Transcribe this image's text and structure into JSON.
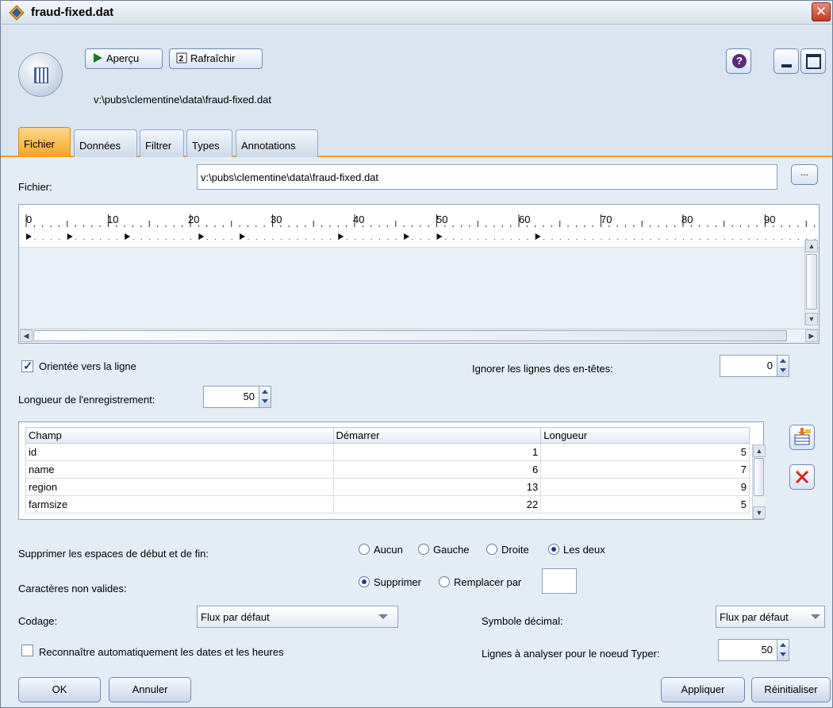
{
  "window": {
    "title": "fraud-fixed.dat",
    "close_label": "✕",
    "file_path": "v:\\pubs\\clementine\\data\\fraud-fixed.dat"
  },
  "toolbar": {
    "preview_label": "Aperçu",
    "refresh_label": "Rafraîchir",
    "help_label": "?"
  },
  "tabs": [
    "Fichier",
    "Données",
    "Filtrer",
    "Types",
    "Annotations"
  ],
  "active_tab": "Fichier",
  "file": {
    "label": "Fichier:",
    "value": "v:\\pubs\\clementine\\data\\fraud-fixed.dat",
    "browse_label": "..."
  },
  "ruler": {
    "tick_labels": [
      "0",
      "10",
      "20",
      "30",
      "40",
      "50",
      "60",
      "70",
      "80",
      "90"
    ],
    "field_markers": [
      0,
      5,
      12,
      21,
      26,
      38,
      46,
      50,
      62
    ]
  },
  "options": {
    "line_oriented_label": "Orientée vers la ligne",
    "line_oriented_checked": true,
    "skip_header_label": "Ignorer les lignes des en-têtes:",
    "skip_header_value": "0",
    "record_length_label": "Longueur de l'enregistrement:",
    "record_length_value": "50"
  },
  "fields_table": {
    "columns": [
      "Champ",
      "Démarrer",
      "Longueur"
    ],
    "rows": [
      [
        "id",
        "1",
        "5"
      ],
      [
        "name",
        "6",
        "7"
      ],
      [
        "region",
        "13",
        "9"
      ],
      [
        "farmsize",
        "22",
        "5"
      ]
    ]
  },
  "trim": {
    "label": "Supprimer les espaces de début et de fin:",
    "options": [
      "Aucun",
      "Gauche",
      "Droite",
      "Les deux"
    ],
    "selected": "Les deux"
  },
  "invalid_chars": {
    "label": "Caractères non valides:",
    "options": [
      "Supprimer",
      "Remplacer par"
    ],
    "selected": "Supprimer",
    "replace_value": ""
  },
  "encoding": {
    "label": "Codage:",
    "value": "Flux par défaut"
  },
  "decimal": {
    "label": "Symbole décimal:",
    "value": "Flux par défaut"
  },
  "dates": {
    "label": "Reconnaître automatiquement les dates et les heures",
    "checked": false
  },
  "type_rows": {
    "label": "Lignes à analyser pour le noeud Typer:",
    "value": "50"
  },
  "buttons": {
    "ok": "OK",
    "cancel": "Annuler",
    "apply": "Appliquer",
    "reset": "Réinitialiser"
  }
}
